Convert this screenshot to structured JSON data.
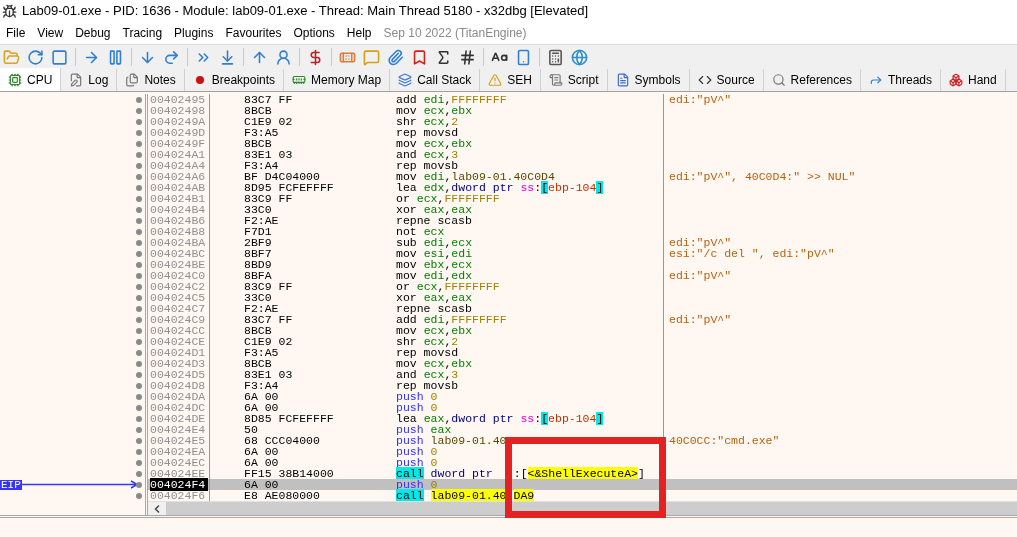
{
  "window": {
    "title": "Lab09-01.exe - PID: 1636 - Module: lab09-01.exe - Thread: Main Thread 5180 - x32dbg [Elevated]"
  },
  "menu": [
    "File",
    "View",
    "Debug",
    "Tracing",
    "Plugins",
    "Favourites",
    "Options",
    "Help"
  ],
  "build_info": "Sep 10 2022 (TitanEngine)",
  "tabs": [
    {
      "label": "CPU",
      "selected": true
    },
    {
      "label": "Log",
      "selected": false
    },
    {
      "label": "Notes",
      "selected": false
    },
    {
      "label": "Breakpoints",
      "selected": false
    },
    {
      "label": "Memory Map",
      "selected": false
    },
    {
      "label": "Call Stack",
      "selected": false
    },
    {
      "label": "SEH",
      "selected": false
    },
    {
      "label": "Script",
      "selected": false
    },
    {
      "label": "Symbols",
      "selected": false
    },
    {
      "label": "Source",
      "selected": false
    },
    {
      "label": "References",
      "selected": false
    },
    {
      "label": "Threads",
      "selected": false
    },
    {
      "label": "Hand",
      "selected": false
    }
  ],
  "eip_marker": "EIP",
  "rows": [
    {
      "address": "00402495",
      "bytes": "83C7 FF",
      "selected": false,
      "tokens": [
        {
          "text": "add",
          "kind": "op"
        },
        {
          "text": "edi",
          "kind": "reg"
        },
        {
          "text": ",",
          "kind": "punct"
        },
        {
          "text": "FFFFFFFF",
          "kind": "num"
        }
      ],
      "comment": "edi:\"pV^\""
    },
    {
      "address": "00402498",
      "bytes": "8BCB",
      "selected": false,
      "tokens": [
        {
          "text": "mov",
          "kind": "op"
        },
        {
          "text": "ecx",
          "kind": "reg"
        },
        {
          "text": ",",
          "kind": "punct"
        },
        {
          "text": "ebx",
          "kind": "reg"
        }
      ]
    },
    {
      "address": "0040249A",
      "bytes": "C1E9 02",
      "selected": false,
      "tokens": [
        {
          "text": "shr",
          "kind": "op"
        },
        {
          "text": "ecx",
          "kind": "reg"
        },
        {
          "text": ",",
          "kind": "punct"
        },
        {
          "text": "2",
          "kind": "num"
        }
      ]
    },
    {
      "address": "0040249D",
      "bytes": "F3:A5",
      "selected": false,
      "tokens": [
        {
          "text": "rep movsd",
          "kind": "op"
        }
      ]
    },
    {
      "address": "0040249F",
      "bytes": "8BCB",
      "selected": false,
      "tokens": [
        {
          "text": "mov",
          "kind": "op"
        },
        {
          "text": "ecx",
          "kind": "reg"
        },
        {
          "text": ",",
          "kind": "punct"
        },
        {
          "text": "ebx",
          "kind": "reg"
        }
      ]
    },
    {
      "address": "004024A1",
      "bytes": "83E1 03",
      "selected": false,
      "tokens": [
        {
          "text": "and",
          "kind": "op"
        },
        {
          "text": "ecx",
          "kind": "reg"
        },
        {
          "text": ",",
          "kind": "punct"
        },
        {
          "text": "3",
          "kind": "num"
        }
      ]
    },
    {
      "address": "004024A4",
      "bytes": "F3:A4",
      "selected": false,
      "tokens": [
        {
          "text": "rep movsb",
          "kind": "op"
        }
      ]
    },
    {
      "address": "004024A6",
      "bytes": "BF D4C04000",
      "selected": false,
      "tokens": [
        {
          "text": "mov",
          "kind": "op"
        },
        {
          "text": "edi",
          "kind": "reg"
        },
        {
          "text": ",",
          "kind": "punct"
        },
        {
          "text": "lab09-01.40C0D4",
          "kind": "label"
        }
      ],
      "comment": "edi:\"pV^\", 40C0D4:\" >> NUL\""
    },
    {
      "address": "004024AB",
      "bytes": "8D95 FCFEFFFF",
      "selected": false,
      "tokens": [
        {
          "text": "lea",
          "kind": "op"
        },
        {
          "text": "edx",
          "kind": "reg"
        },
        {
          "text": ",",
          "kind": "punct"
        },
        {
          "text": "dword ptr",
          "kind": "size"
        },
        {
          "text": "ss",
          "kind": "seg"
        },
        {
          "text": ":",
          "kind": "punct"
        },
        {
          "text": "[",
          "kind": "bracket"
        },
        {
          "text": "ebp-104",
          "kind": "mem"
        },
        {
          "text": "]",
          "kind": "bracket"
        }
      ]
    },
    {
      "address": "004024B1",
      "bytes": "83C9 FF",
      "selected": false,
      "tokens": [
        {
          "text": "or",
          "kind": "op"
        },
        {
          "text": "ecx",
          "kind": "reg"
        },
        {
          "text": ",",
          "kind": "punct"
        },
        {
          "text": "FFFFFFFF",
          "kind": "num"
        }
      ]
    },
    {
      "address": "004024B4",
      "bytes": "33C0",
      "selected": false,
      "tokens": [
        {
          "text": "xor",
          "kind": "op"
        },
        {
          "text": "eax",
          "kind": "reg"
        },
        {
          "text": ",",
          "kind": "punct"
        },
        {
          "text": "eax",
          "kind": "reg"
        }
      ]
    },
    {
      "address": "004024B6",
      "bytes": "F2:AE",
      "selected": false,
      "tokens": [
        {
          "text": "repne scasb",
          "kind": "op"
        }
      ]
    },
    {
      "address": "004024B8",
      "bytes": "F7D1",
      "selected": false,
      "tokens": [
        {
          "text": "not",
          "kind": "op"
        },
        {
          "text": "ecx",
          "kind": "reg"
        }
      ]
    },
    {
      "address": "004024BA",
      "bytes": "2BF9",
      "selected": false,
      "tokens": [
        {
          "text": "sub",
          "kind": "op"
        },
        {
          "text": "edi",
          "kind": "reg"
        },
        {
          "text": ",",
          "kind": "punct"
        },
        {
          "text": "ecx",
          "kind": "reg"
        }
      ],
      "comment": "edi:\"pV^\""
    },
    {
      "address": "004024BC",
      "bytes": "8BF7",
      "selected": false,
      "tokens": [
        {
          "text": "mov",
          "kind": "op"
        },
        {
          "text": "esi",
          "kind": "reg"
        },
        {
          "text": ",",
          "kind": "punct"
        },
        {
          "text": "edi",
          "kind": "reg"
        }
      ],
      "comment": "esi:\"/c del \", edi:\"pV^\""
    },
    {
      "address": "004024BE",
      "bytes": "8BD9",
      "selected": false,
      "tokens": [
        {
          "text": "mov",
          "kind": "op"
        },
        {
          "text": "ebx",
          "kind": "reg"
        },
        {
          "text": ",",
          "kind": "punct"
        },
        {
          "text": "ecx",
          "kind": "reg"
        }
      ]
    },
    {
      "address": "004024C0",
      "bytes": "8BFA",
      "selected": false,
      "tokens": [
        {
          "text": "mov",
          "kind": "op"
        },
        {
          "text": "edi",
          "kind": "reg"
        },
        {
          "text": ",",
          "kind": "punct"
        },
        {
          "text": "edx",
          "kind": "reg"
        }
      ],
      "comment": "edi:\"pV^\""
    },
    {
      "address": "004024C2",
      "bytes": "83C9 FF",
      "selected": false,
      "tokens": [
        {
          "text": "or",
          "kind": "op"
        },
        {
          "text": "ecx",
          "kind": "reg"
        },
        {
          "text": ",",
          "kind": "punct"
        },
        {
          "text": "FFFFFFFF",
          "kind": "num"
        }
      ]
    },
    {
      "address": "004024C5",
      "bytes": "33C0",
      "selected": false,
      "tokens": [
        {
          "text": "xor",
          "kind": "op"
        },
        {
          "text": "eax",
          "kind": "reg"
        },
        {
          "text": ",",
          "kind": "punct"
        },
        {
          "text": "eax",
          "kind": "reg"
        }
      ]
    },
    {
      "address": "004024C7",
      "bytes": "F2:AE",
      "selected": false,
      "tokens": [
        {
          "text": "repne scasb",
          "kind": "op"
        }
      ]
    },
    {
      "address": "004024C9",
      "bytes": "83C7 FF",
      "selected": false,
      "tokens": [
        {
          "text": "add",
          "kind": "op"
        },
        {
          "text": "edi",
          "kind": "reg"
        },
        {
          "text": ",",
          "kind": "punct"
        },
        {
          "text": "FFFFFFFF",
          "kind": "num"
        }
      ],
      "comment": "edi:\"pV^\""
    },
    {
      "address": "004024CC",
      "bytes": "8BCB",
      "selected": false,
      "tokens": [
        {
          "text": "mov",
          "kind": "op"
        },
        {
          "text": "ecx",
          "kind": "reg"
        },
        {
          "text": ",",
          "kind": "punct"
        },
        {
          "text": "ebx",
          "kind": "reg"
        }
      ]
    },
    {
      "address": "004024CE",
      "bytes": "C1E9 02",
      "selected": false,
      "tokens": [
        {
          "text": "shr",
          "kind": "op"
        },
        {
          "text": "ecx",
          "kind": "reg"
        },
        {
          "text": ",",
          "kind": "punct"
        },
        {
          "text": "2",
          "kind": "num"
        }
      ]
    },
    {
      "address": "004024D1",
      "bytes": "F3:A5",
      "selected": false,
      "tokens": [
        {
          "text": "rep movsd",
          "kind": "op"
        }
      ]
    },
    {
      "address": "004024D3",
      "bytes": "8BCB",
      "selected": false,
      "tokens": [
        {
          "text": "mov",
          "kind": "op"
        },
        {
          "text": "ecx",
          "kind": "reg"
        },
        {
          "text": ",",
          "kind": "punct"
        },
        {
          "text": "ebx",
          "kind": "reg"
        }
      ]
    },
    {
      "address": "004024D5",
      "bytes": "83E1 03",
      "selected": false,
      "tokens": [
        {
          "text": "and",
          "kind": "op"
        },
        {
          "text": "ecx",
          "kind": "reg"
        },
        {
          "text": ",",
          "kind": "punct"
        },
        {
          "text": "3",
          "kind": "num"
        }
      ]
    },
    {
      "address": "004024D8",
      "bytes": "F3:A4",
      "selected": false,
      "tokens": [
        {
          "text": "rep movsb",
          "kind": "op"
        }
      ]
    },
    {
      "address": "004024DA",
      "bytes": "6A 00",
      "selected": false,
      "tokens": [
        {
          "text": "push",
          "kind": "push"
        },
        {
          "text": "0",
          "kind": "num"
        }
      ]
    },
    {
      "address": "004024DC",
      "bytes": "6A 00",
      "selected": false,
      "tokens": [
        {
          "text": "push",
          "kind": "push"
        },
        {
          "text": "0",
          "kind": "num"
        }
      ]
    },
    {
      "address": "004024DE",
      "bytes": "8D85 FCFEFFFF",
      "selected": false,
      "tokens": [
        {
          "text": "lea",
          "kind": "op"
        },
        {
          "text": "eax",
          "kind": "reg"
        },
        {
          "text": ",",
          "kind": "punct"
        },
        {
          "text": "dword ptr",
          "kind": "size"
        },
        {
          "text": "ss",
          "kind": "seg"
        },
        {
          "text": ":",
          "kind": "punct"
        },
        {
          "text": "[",
          "kind": "bracket"
        },
        {
          "text": "ebp-104",
          "kind": "mem"
        },
        {
          "text": "]",
          "kind": "bracket"
        }
      ]
    },
    {
      "address": "004024E4",
      "bytes": "50",
      "selected": false,
      "tokens": [
        {
          "text": "push",
          "kind": "push"
        },
        {
          "text": "eax",
          "kind": "reg"
        }
      ]
    },
    {
      "address": "004024E5",
      "bytes": "68 CCC04000",
      "selected": false,
      "tokens": [
        {
          "text": "push",
          "kind": "push"
        },
        {
          "text": "lab09-01.40",
          "kind": "label"
        }
      ],
      "comment": "40C0CC:\"cmd.exe\""
    },
    {
      "address": "004024EA",
      "bytes": "6A 00",
      "selected": false,
      "tokens": [
        {
          "text": "push",
          "kind": "push"
        },
        {
          "text": "0",
          "kind": "num"
        }
      ]
    },
    {
      "address": "004024EC",
      "bytes": "6A 00",
      "selected": false,
      "tokens": [
        {
          "text": "push",
          "kind": "push"
        },
        {
          "text": "0",
          "kind": "num"
        }
      ]
    },
    {
      "address": "004024EE",
      "bytes": "FF15 38B14000",
      "selected": false,
      "tokens": [
        {
          "text": "call",
          "kind": "call"
        },
        {
          "text": "dword ptr",
          "kind": "size"
        },
        {
          "text": ":",
          "kind": "punct_after_gap"
        },
        {
          "text": "[",
          "kind": "punct"
        },
        {
          "text": "<&ShellExecuteA>",
          "kind": "target"
        },
        {
          "text": "]",
          "kind": "punct"
        }
      ]
    },
    {
      "address": "004024F4",
      "bytes": "6A 00",
      "selected": true,
      "tokens": [
        {
          "text": "push",
          "kind": "push"
        },
        {
          "text": "0",
          "kind": "num"
        }
      ]
    },
    {
      "address": "004024F6",
      "bytes": "E8 AE080000",
      "selected": false,
      "tokens": [
        {
          "text": "call",
          "kind": "call"
        },
        {
          "text": "lab09-01.40",
          "kind": "target"
        },
        {
          "text": "DA9",
          "kind": "target_after_gap"
        }
      ]
    }
  ]
}
